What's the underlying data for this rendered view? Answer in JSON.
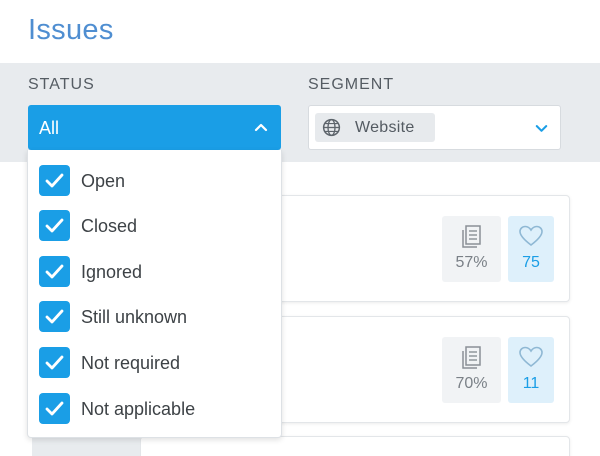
{
  "title": "Issues",
  "filters": {
    "status": {
      "label": "STATUS",
      "value": "All",
      "options": [
        {
          "label": "Open",
          "checked": true
        },
        {
          "label": "Closed",
          "checked": true
        },
        {
          "label": "Ignored",
          "checked": true
        },
        {
          "label": "Still unknown",
          "checked": true
        },
        {
          "label": "Not required",
          "checked": true
        },
        {
          "label": "Not applicable",
          "checked": true
        }
      ]
    },
    "segment": {
      "label": "SEGMENT",
      "value": "Website",
      "icon": "globe-icon"
    }
  },
  "cards": [
    {
      "doc_percent": "57%",
      "likes": "75"
    },
    {
      "doc_percent": "70%",
      "likes": "11"
    }
  ],
  "colors": {
    "accent": "#1a9ee6",
    "title": "#4f8ed1",
    "filter_bar": "#e8ebee",
    "like_bg": "#def0fb"
  }
}
